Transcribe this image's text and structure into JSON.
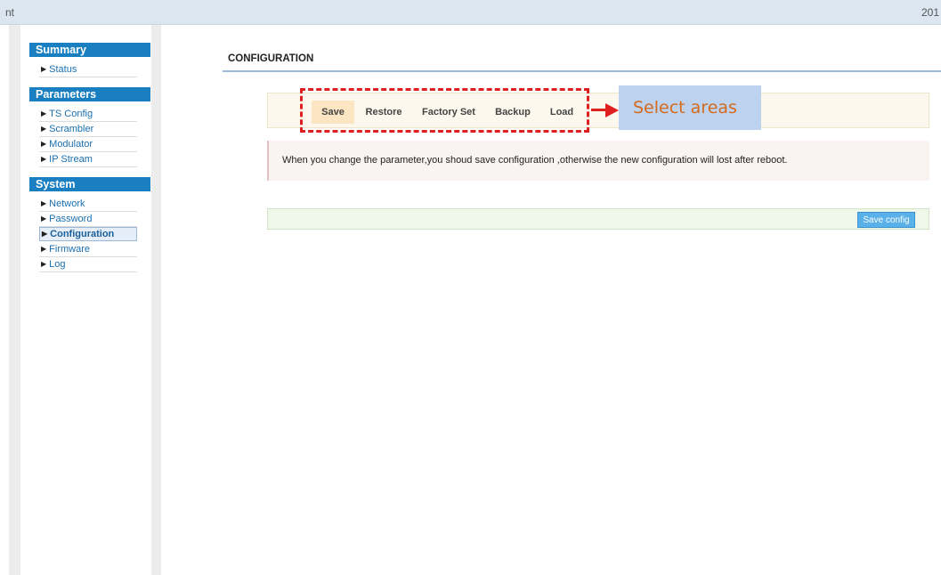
{
  "header": {
    "left_fragment": "nt",
    "right_fragment": "201"
  },
  "sidebar": {
    "sections": [
      {
        "title": "Summary",
        "items": [
          "Status"
        ]
      },
      {
        "title": "Parameters",
        "items": [
          "TS Config",
          "Scrambler",
          "Modulator",
          "IP Stream"
        ]
      },
      {
        "title": "System",
        "items": [
          "Network",
          "Password",
          "Configuration",
          "Firmware",
          "Log"
        ]
      }
    ],
    "active_item": "Configuration"
  },
  "main": {
    "page_title": "CONFIGURATION",
    "actions": [
      "Save",
      "Restore",
      "Factory Set",
      "Backup",
      "Load"
    ],
    "active_action": "Save",
    "callout": "Select areas",
    "warning": "When you change the parameter,you shoud save configuration ,otherwise the new configuration will lost after reboot.",
    "save_button": "Save config"
  },
  "colors": {
    "section_header": "#1a7fc1",
    "link": "#1a6fb0",
    "annotation_red": "#e02020",
    "callout_bg": "#bcd2ee",
    "callout_text": "#d56a1c",
    "save_button": "#5ab0e8"
  },
  "icons": {
    "nav_bullet": "triangle-right-icon",
    "annotation_arrow": "arrow-right-icon"
  }
}
